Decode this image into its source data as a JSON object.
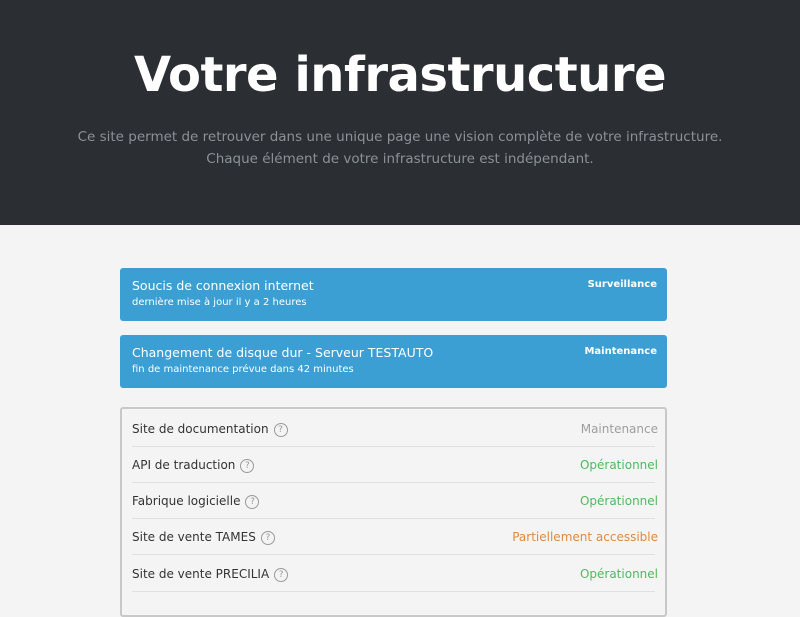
{
  "hero": {
    "title": "Votre infrastructure",
    "description_line1": "Ce site permet de retrouver dans une unique page une vision complète de votre infrastructure.",
    "description_line2": "Chaque élément de votre infrastructure est indépendant."
  },
  "notices": [
    {
      "title": "Soucis de connexion internet",
      "subtitle": "dernière mise à jour il y a 2 heures",
      "tag": "Surveillance"
    },
    {
      "title": "Changement de disque dur - Serveur TESTAUTO",
      "subtitle": "fin de maintenance prévue dans 42 minutes",
      "tag": "Maintenance"
    }
  ],
  "services": [
    {
      "name": "Site de documentation",
      "help": "?",
      "status": "Maintenance",
      "status_color": "#9e9e9e"
    },
    {
      "name": "API de traduction",
      "help": "?",
      "status": "Opérationnel",
      "status_color": "#4cbb5e"
    },
    {
      "name": "Fabrique logicielle",
      "help": "?",
      "status": "Opérationnel",
      "status_color": "#4cbb5e"
    },
    {
      "name": "Site de vente TAMES",
      "help": "?",
      "status": "Partiellement accessible",
      "status_color": "#e08a3c"
    },
    {
      "name": "Site de vente PRECILIA",
      "help": "?",
      "status": "Opérationnel",
      "status_color": "#4cbb5e"
    }
  ],
  "colors": {
    "hero_background": "#2b2f33",
    "notice_background": "#3b9fd4",
    "page_background": "#f4f4f4"
  }
}
